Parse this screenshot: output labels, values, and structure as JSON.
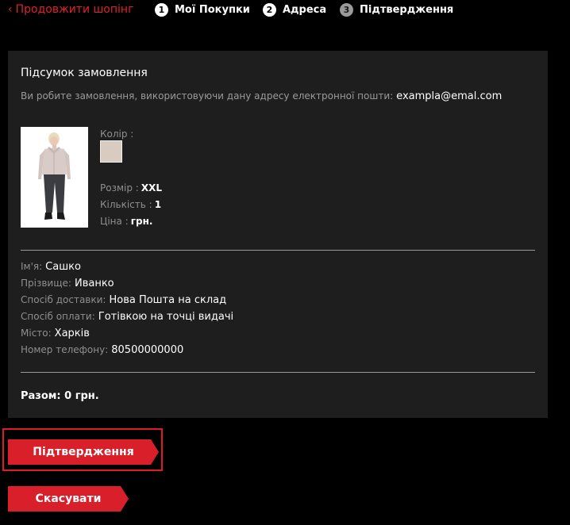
{
  "topbar": {
    "back_label": "Продовжити шопінг",
    "steps": [
      {
        "number": "1",
        "label": "Мої Покупки",
        "active": true
      },
      {
        "number": "2",
        "label": "Адреса",
        "active": true
      },
      {
        "number": "3",
        "label": "Підтвердження",
        "active": false
      }
    ]
  },
  "summary": {
    "title": "Підсумок замовлення",
    "email_note": "Ви робите замовлення, використовуючи дану адресу електронної пошти:",
    "email": "exampla@emal.com",
    "product": {
      "color_label": "Колір :",
      "color_swatch": "#d8cbc0",
      "size_label": "Розмір :",
      "size_value": "XXL",
      "qty_label": "Кількість :",
      "qty_value": "1",
      "price_label": "Ціна :",
      "price_value": "грн."
    },
    "customer": {
      "name_label": "Ім'я:",
      "name_value": "Сашко",
      "surname_label": "Прізвище:",
      "surname_value": "Иванко",
      "delivery_label": "Спосіб доставки:",
      "delivery_value": "Нова Пошта на склад",
      "payment_label": "Спосіб оплати:",
      "payment_value": "Готівкою на точці видачі",
      "city_label": "Місто:",
      "city_value": "Харків",
      "phone_label": "Номер телефону:",
      "phone_value": "80500000000"
    },
    "total": "Разом: 0 грн."
  },
  "actions": {
    "confirm_label": "Підтвердження",
    "cancel_label": "Скасувати"
  },
  "colors": {
    "accent": "#d81f2a",
    "panel": "#1e1e1e"
  }
}
